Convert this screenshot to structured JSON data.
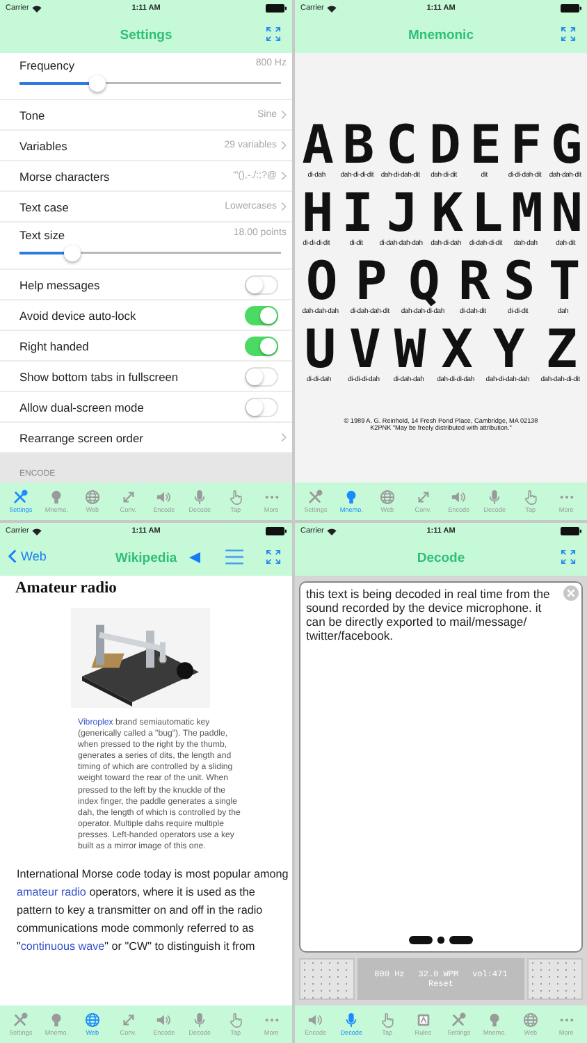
{
  "screens": [
    {
      "kind": "settings",
      "status_bar": {
        "carrier": "Carrier",
        "time": "1:11 AM"
      },
      "title": "Settings",
      "rows": [
        {
          "kind": "slider",
          "label": "Frequency",
          "value": "800 Hz",
          "level": 0.3
        },
        {
          "kind": "detail",
          "label": "Tone",
          "value": "Sine"
        },
        {
          "kind": "detail",
          "label": "Variables",
          "value": "29 variables"
        },
        {
          "kind": "detail",
          "label": "Morse characters",
          "value": "'\"(),-./:;?@"
        },
        {
          "kind": "detail",
          "label": "Text case",
          "value": "Lowercases"
        },
        {
          "kind": "slider",
          "label": "Text size",
          "value": "18.00 points",
          "level": 0.2
        },
        {
          "kind": "toggle",
          "label": "Help messages",
          "on": false
        },
        {
          "kind": "toggle",
          "label": "Avoid device auto-lock",
          "on": true
        },
        {
          "kind": "toggle",
          "label": "Right handed",
          "on": true
        },
        {
          "kind": "toggle",
          "label": "Show bottom tabs in fullscreen",
          "on": false
        },
        {
          "kind": "toggle",
          "label": "Allow dual-screen mode",
          "on": false
        },
        {
          "kind": "link",
          "label": "Rearrange screen order"
        }
      ],
      "section_header": "ENCODE",
      "tabs": [
        {
          "kind": "tools",
          "label": "Settings",
          "selected": true
        },
        {
          "kind": "bulb",
          "label": "Mnemo.",
          "selected": false
        },
        {
          "kind": "globe",
          "label": "Web",
          "selected": false
        },
        {
          "kind": "arrows",
          "label": "Conv.",
          "selected": false
        },
        {
          "kind": "speaker",
          "label": "Encode",
          "selected": false
        },
        {
          "kind": "mic",
          "label": "Decode",
          "selected": false
        },
        {
          "kind": "hand",
          "label": "Tap",
          "selected": false
        },
        {
          "kind": "dots",
          "label": "More",
          "selected": false
        }
      ]
    },
    {
      "kind": "mnemonic",
      "status_bar": {
        "carrier": "Carrier",
        "time": "1:11 AM"
      },
      "title": "Mnemonic",
      "letter_rows": [
        [
          {
            "letter": "A",
            "code": "di-dah"
          },
          {
            "letter": "B",
            "code": "dah-di-di-dit"
          },
          {
            "letter": "C",
            "code": "dah-di-dah-dit"
          },
          {
            "letter": "D",
            "code": "dah-di-dit"
          },
          {
            "letter": "E",
            "code": "dit"
          },
          {
            "letter": "F",
            "code": "di-di-dah-dit"
          },
          {
            "letter": "G",
            "code": "dah-dah-dit"
          }
        ],
        [
          {
            "letter": "H",
            "code": "di-di-di-dit"
          },
          {
            "letter": "I",
            "code": "di-dit"
          },
          {
            "letter": "J",
            "code": "di-dah-dah-dah"
          },
          {
            "letter": "K",
            "code": "dah-di-dah"
          },
          {
            "letter": "L",
            "code": "di-dah-di-dit"
          },
          {
            "letter": "M",
            "code": "dah-dah"
          },
          {
            "letter": "N",
            "code": "dah-dit"
          }
        ],
        [
          {
            "letter": "O",
            "code": "dah-dah-dah"
          },
          {
            "letter": "P",
            "code": "di-dah-dah-dit"
          },
          {
            "letter": "Q",
            "code": "dah-dah-di-dah"
          },
          {
            "letter": "R",
            "code": "di-dah-dit"
          },
          {
            "letter": "S",
            "code": "di-di-dit"
          },
          {
            "letter": "T",
            "code": "dah"
          }
        ],
        [
          {
            "letter": "U",
            "code": "di-di-dah"
          },
          {
            "letter": "V",
            "code": "di-di-di-dah"
          },
          {
            "letter": "W",
            "code": "di-dah-dah"
          },
          {
            "letter": "X",
            "code": "dah-di-di-dah"
          },
          {
            "letter": "Y",
            "code": "dah-di-dah-dah"
          },
          {
            "letter": "Z",
            "code": "dah-dah-di-dit"
          }
        ]
      ],
      "credit": [
        "© 1989 A. G. Reinhold, 14 Fresh Pond Place, Cambridge, MA 02138",
        "K2PNK  \"May be freely distributed with attribution.\""
      ],
      "tabs": [
        {
          "kind": "tools",
          "label": "Settings",
          "selected": false
        },
        {
          "kind": "bulb",
          "label": "Mnemo.",
          "selected": true
        },
        {
          "kind": "globe",
          "label": "Web",
          "selected": false
        },
        {
          "kind": "arrows",
          "label": "Conv.",
          "selected": false
        },
        {
          "kind": "speaker",
          "label": "Encode",
          "selected": false
        },
        {
          "kind": "mic",
          "label": "Decode",
          "selected": false
        },
        {
          "kind": "hand",
          "label": "Tap",
          "selected": false
        },
        {
          "kind": "dots",
          "label": "More",
          "selected": false
        }
      ]
    },
    {
      "kind": "web",
      "status_bar": {
        "carrier": "Carrier",
        "time": "1:11 AM"
      },
      "back": "Web",
      "title": "Wikipedia",
      "heading": "Amateur radio",
      "image": {
        "kind": "picture"
      },
      "caption": [
        {
          "text": "Vibroplex",
          "link": true
        },
        {
          "text": " brand semiautomatic key (generically called a \"bug\"). The paddle, when pressed to the right by the thumb, generates a series of dits, the length and timing of which are controlled by a sliding weight toward the rear of the unit. When pressed to the left by the knuckle of the index finger, the paddle generates a single dah, the length of which is controlled by the operator. Multiple dahs require multiple presses. Left-handed operators use a key built as a mirror image of this one.",
          "link": false
        }
      ],
      "paragraph": [
        {
          "text": "International Morse code today is most popular among ",
          "link": false
        },
        {
          "text": "amateur radio",
          "link": true
        },
        {
          "text": " operators, where it is used as the pattern to key a transmitter on and off in the radio communications mode commonly referred to as \"",
          "link": false
        },
        {
          "text": "continuous wave",
          "link": true
        },
        {
          "text": "\" or \"CW\" to distinguish it from",
          "link": false
        }
      ],
      "tabs": [
        {
          "kind": "tools",
          "label": "Settings",
          "selected": false
        },
        {
          "kind": "bulb",
          "label": "Mnemo.",
          "selected": false
        },
        {
          "kind": "globe",
          "label": "Web",
          "selected": true
        },
        {
          "kind": "arrows",
          "label": "Conv.",
          "selected": false
        },
        {
          "kind": "speaker",
          "label": "Encode",
          "selected": false
        },
        {
          "kind": "mic",
          "label": "Decode",
          "selected": false
        },
        {
          "kind": "hand",
          "label": "Tap",
          "selected": false
        },
        {
          "kind": "dots",
          "label": "More",
          "selected": false
        }
      ]
    },
    {
      "kind": "decode",
      "status_bar": {
        "carrier": "Carrier",
        "time": "1:11 AM"
      },
      "title": "Decode",
      "decoded_text": "this text is being decoded in real time from the sound recorded by the device microphone. it can be directly exported to mail/message/ twitter/facebook.",
      "readouts": [
        "800 Hz",
        "32.0 WPM",
        "vol:471"
      ],
      "reset": "Reset",
      "tabs": [
        {
          "kind": "speaker",
          "label": "Encode",
          "selected": false
        },
        {
          "kind": "mic",
          "label": "Decode",
          "selected": true
        },
        {
          "kind": "hand",
          "label": "Tap",
          "selected": false
        },
        {
          "kind": "rules",
          "label": "Rules",
          "selected": false
        },
        {
          "kind": "tools",
          "label": "Settings",
          "selected": false
        },
        {
          "kind": "bulb",
          "label": "Mnemo.",
          "selected": false
        },
        {
          "kind": "globe",
          "label": "Web",
          "selected": false
        },
        {
          "kind": "dots",
          "label": "More",
          "selected": false
        }
      ]
    }
  ]
}
